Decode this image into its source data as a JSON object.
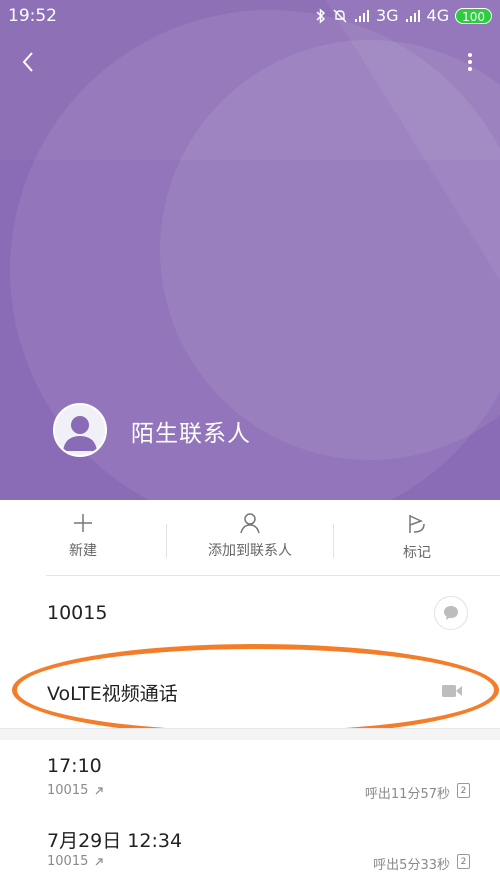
{
  "status_bar": {
    "time": "19:52",
    "network_1": "3G",
    "network_2": "4G",
    "battery": "100",
    "icons": [
      "bluetooth-icon",
      "mute-bell-icon",
      "signal-icon",
      "hd-icon",
      "signal-icon-2"
    ]
  },
  "header": {
    "contact_name": "陌生联系人",
    "background_color": "#8a6bb5"
  },
  "actions": [
    {
      "label": "新建",
      "icon": "plus-icon"
    },
    {
      "label": "添加到联系人",
      "icon": "person-icon"
    },
    {
      "label": "标记",
      "icon": "flag-icon"
    }
  ],
  "number": {
    "value": "10015",
    "icon": "message-icon"
  },
  "volte": {
    "label": "VoLTE视频通话",
    "icon": "video-camera-icon",
    "highlight_color": "#f47d2a"
  },
  "call_log": [
    {
      "time": "17:10",
      "number": "10015",
      "status": "呼出11分57秒",
      "sim": "2"
    },
    {
      "time": "7月29日 12:34",
      "number": "10015",
      "status": "呼出5分33秒",
      "sim": "2"
    }
  ]
}
